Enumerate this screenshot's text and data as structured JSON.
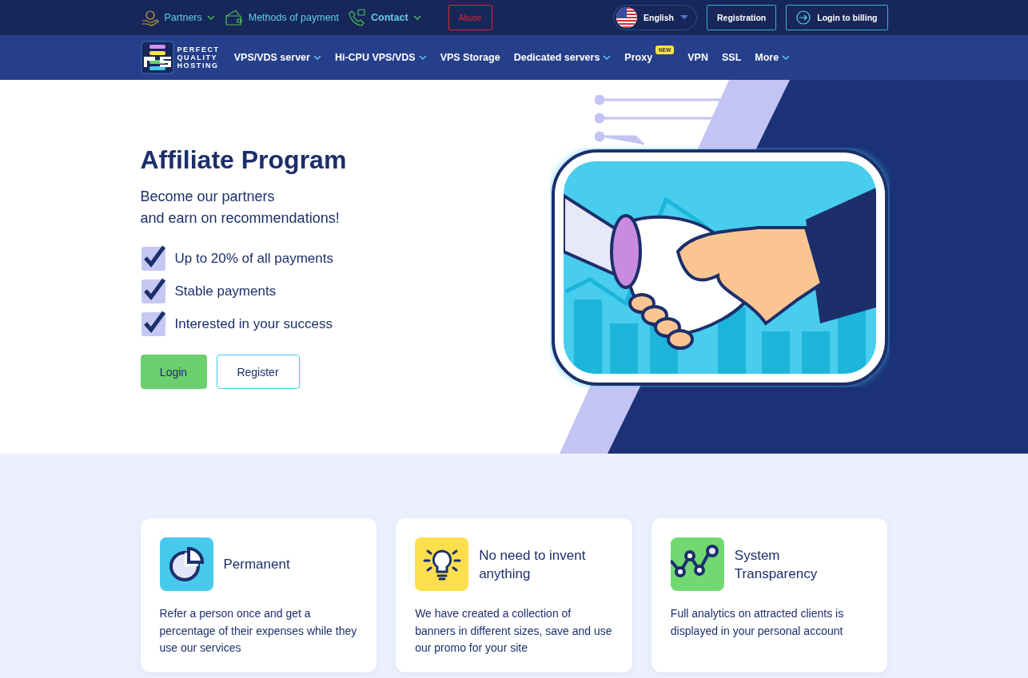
{
  "top_bar": {
    "links": [
      {
        "label": "Partners",
        "kind": "dropdown",
        "bold": false
      },
      {
        "label": "Methods of payment",
        "kind": "plain",
        "bold": false
      },
      {
        "label": "Contact",
        "kind": "dropdown",
        "bold": true
      }
    ],
    "abuse": "Abuse",
    "language": "English",
    "registration": "Registration",
    "login": "Login to billing"
  },
  "nav": {
    "logo_lines": [
      "PERFECT",
      "QUALITY",
      "HOSTING"
    ],
    "items": [
      {
        "label": "VPS/VDS server",
        "dropdown": true
      },
      {
        "label": "Hi-CPU VPS/VDS",
        "dropdown": true
      },
      {
        "label": "VPS Storage",
        "dropdown": false
      },
      {
        "label": "Dedicated servers",
        "dropdown": true
      },
      {
        "label": "Proxy",
        "dropdown": false,
        "badge": "NEW"
      },
      {
        "label": "VPN",
        "dropdown": false
      },
      {
        "label": "SSL",
        "dropdown": false
      },
      {
        "label": "More",
        "dropdown": true
      }
    ]
  },
  "hero": {
    "title": "Affiliate Program",
    "subtitle": [
      "Become our partners",
      "and earn on recommendations!"
    ],
    "features": [
      {
        "label": "Up to 20% of all payments",
        "checked": true
      },
      {
        "label": "Stable payments",
        "checked": true
      },
      {
        "label": "Interested in your success",
        "checked": true
      }
    ],
    "buttons": [
      {
        "label": "Login",
        "kind": "primary"
      },
      {
        "label": "Register",
        "kind": "outline"
      }
    ]
  },
  "cards": [
    {
      "title": "Permanent",
      "color": "#46c9ec",
      "text": "Refer a person once and get a percentage of their expenses while they use our services"
    },
    {
      "title": "No need to invent anything",
      "color": "#fddf4e",
      "text": "We have created a collection of banners in different sizes, save and use our promo for your site"
    },
    {
      "title": "System Transparency",
      "color": "#72d972",
      "text": "Full analytics on attracted clients is displayed in your personal account"
    }
  ]
}
